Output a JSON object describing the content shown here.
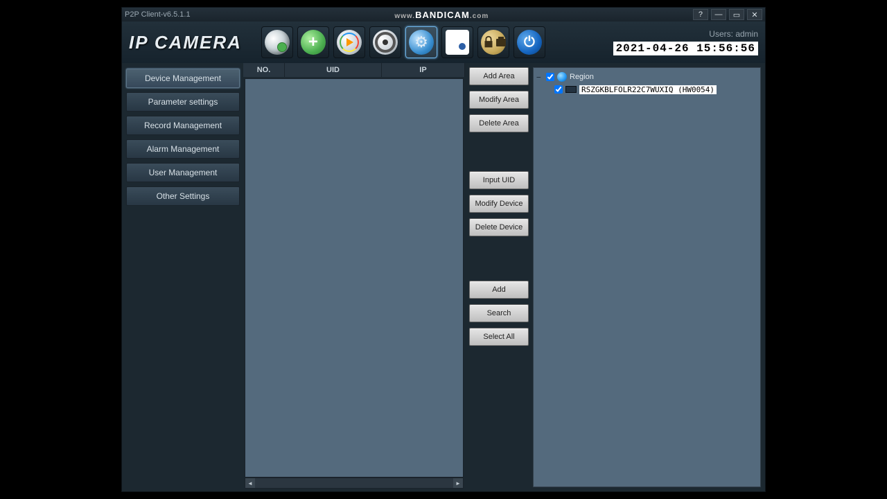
{
  "title": "P2P Client-v6.5.1.1",
  "watermark": {
    "prefix": "www.",
    "brand": "BANDICAM",
    "suffix": ".com"
  },
  "window_buttons": {
    "help": "?",
    "min": "—",
    "max": "▭",
    "close": "✕"
  },
  "logo": "IP CAMERA",
  "user_label": "Users:",
  "user_name": "admin",
  "datetime": "2021-04-26 15:56:56",
  "toolbar": [
    {
      "id": "webcam",
      "name": "toolbar-live-view",
      "icon": "ic-webcam"
    },
    {
      "id": "add",
      "name": "toolbar-add-device",
      "icon": "ic-plus"
    },
    {
      "id": "playback",
      "name": "toolbar-playback",
      "icon": "ic-play"
    },
    {
      "id": "record",
      "name": "toolbar-record",
      "icon": "ic-record"
    },
    {
      "id": "settings",
      "name": "toolbar-settings",
      "icon": "ic-settings",
      "active": true
    },
    {
      "id": "log",
      "name": "toolbar-log",
      "icon": "ic-log"
    },
    {
      "id": "lock",
      "name": "toolbar-lock",
      "icon": "ic-lock"
    },
    {
      "id": "power",
      "name": "toolbar-power",
      "icon": "ic-power"
    }
  ],
  "sidebar": {
    "items": [
      {
        "label": "Device Management",
        "active": true
      },
      {
        "label": "Parameter settings",
        "active": false
      },
      {
        "label": "Record Management",
        "active": false
      },
      {
        "label": "Alarm Management",
        "active": false
      },
      {
        "label": "User Management",
        "active": false
      },
      {
        "label": "Other Settings",
        "active": false
      }
    ]
  },
  "list_columns": {
    "no": "NO.",
    "uid": "UID",
    "ip": "IP"
  },
  "action_buttons": {
    "group1": [
      "Add Area",
      "Modify Area",
      "Delete Area"
    ],
    "group2": [
      "Input UID",
      "Modify Device",
      "Delete Device"
    ],
    "group3": [
      "Add",
      "Search",
      "Select All"
    ]
  },
  "tree": {
    "root_label": "Region",
    "root_checked": true,
    "children": [
      {
        "label": "RSZGKBLFOLR22C7WUXIQ (HW0054)",
        "checked": true
      }
    ]
  }
}
